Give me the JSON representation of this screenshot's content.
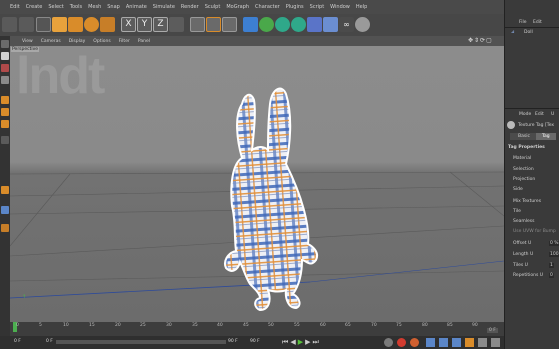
{
  "menu": [
    "Edit",
    "Create",
    "Select",
    "Tools",
    "Mesh",
    "Snap",
    "Animate",
    "Simulate",
    "Render",
    "Sculpt",
    "MoGraph",
    "Character",
    "Plugins",
    "Script",
    "Window",
    "Help"
  ],
  "viewport": {
    "menu": [
      "View",
      "Cameras",
      "Display",
      "Options",
      "Filter",
      "Panel"
    ],
    "camera_label": "Perspective",
    "watermark": "lndt"
  },
  "timeline": {
    "ticks": [
      "0",
      "5",
      "10",
      "15",
      "20",
      "25",
      "30",
      "35",
      "40",
      "45",
      "50",
      "55",
      "60",
      "65",
      "70",
      "75",
      "80",
      "85",
      "90"
    ],
    "end_value": "0 F",
    "current_frame": "0 F",
    "range_start": "0 F",
    "range_end": "90 F"
  },
  "object_manager": {
    "menu": [
      "File",
      "Edit"
    ],
    "object_name": "Doll"
  },
  "attributes": {
    "menu": [
      "Mode",
      "Edit",
      "U"
    ],
    "header": "Texture Tag [Tex",
    "tabs": [
      "Basic",
      "Tag"
    ],
    "section": "Tag Properties",
    "fields": [
      {
        "label": "Material",
        "value": ""
      },
      {
        "label": "Selection",
        "value": ""
      },
      {
        "label": "Projection",
        "value": ""
      },
      {
        "label": "Side",
        "value": ""
      },
      {
        "label": "Mix Textures",
        "value": ""
      },
      {
        "label": "Tile",
        "value": ""
      },
      {
        "label": "Seamless",
        "value": ""
      },
      {
        "label": "Use UVW for Bump",
        "value": ""
      },
      {
        "label": "Offset U",
        "value": "0 %"
      },
      {
        "label": "Length U",
        "value": "100"
      },
      {
        "label": "Tiles U",
        "value": "1"
      },
      {
        "label": "Repetitions U",
        "value": "0"
      }
    ]
  },
  "colors": {
    "accent": "#e8a23c",
    "play": "#58c23a",
    "record": "#d23b2f"
  }
}
